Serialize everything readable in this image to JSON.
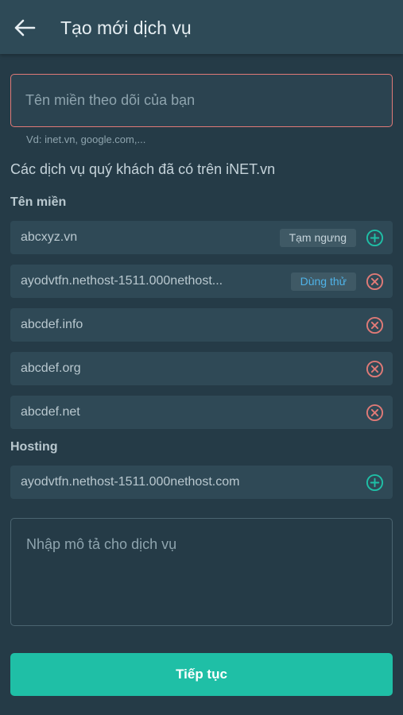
{
  "header": {
    "title": "Tạo mới dịch vụ",
    "back_icon": "arrow-left-icon"
  },
  "domain_input": {
    "placeholder": "Tên miền theo dõi của bạn",
    "value": ""
  },
  "hint": "Vd: inet.vn, google.com,...",
  "section_intro": "Các dịch vụ quý khách đã có trên iNET.vn",
  "domains": {
    "label": "Tên miền",
    "items": [
      {
        "name": "abcxyz.vn",
        "badge": "Tạm ngưng",
        "action": "add"
      },
      {
        "name": "ayodvtfn.nethost-1511.000nethost...",
        "badge": "Dùng thử",
        "action": "remove"
      },
      {
        "name": "abcdef.info",
        "badge": "",
        "action": "remove"
      },
      {
        "name": "abcdef.org",
        "badge": "",
        "action": "remove"
      },
      {
        "name": "abcdef.net",
        "badge": "",
        "action": "remove"
      }
    ]
  },
  "hosting": {
    "label": "Hosting",
    "items": [
      {
        "name": "ayodvtfn.nethost-1511.000nethost.com",
        "action": "add"
      }
    ]
  },
  "description": {
    "placeholder": "Nhập mô tả cho dịch vụ",
    "value": ""
  },
  "submit_label": "Tiếp tục",
  "colors": {
    "background": "#253b47",
    "accent": "#1fbfa6",
    "danger": "#e07a77",
    "badge_paused_text": "#c5d3da",
    "badge_trial_text": "#4fb3e8"
  }
}
